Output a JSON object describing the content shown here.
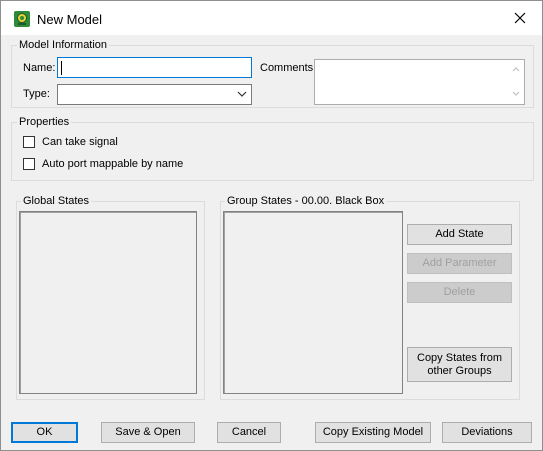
{
  "window": {
    "title": "New Model"
  },
  "model_information": {
    "legend": "Model Information",
    "name_label": "Name:",
    "name_value": "",
    "type_label": "Type:",
    "type_value": "",
    "comments_label": "Comments:",
    "comments_value": ""
  },
  "properties": {
    "legend": "Properties",
    "can_take_signal": {
      "label": "Can take signal",
      "checked": false
    },
    "auto_port": {
      "label": "Auto port mappable by name",
      "checked": false
    }
  },
  "global_states": {
    "legend": "Global States"
  },
  "group_states": {
    "legend": "Group States - 00.00. Black Box",
    "add_state": "Add State",
    "add_parameter": "Add Parameter",
    "delete": "Delete",
    "copy_states_line1": "Copy States from",
    "copy_states_line2": "other Groups"
  },
  "footer": {
    "ok": "OK",
    "save_open": "Save & Open",
    "cancel": "Cancel",
    "copy_existing": "Copy Existing Model",
    "deviations": "Deviations"
  }
}
